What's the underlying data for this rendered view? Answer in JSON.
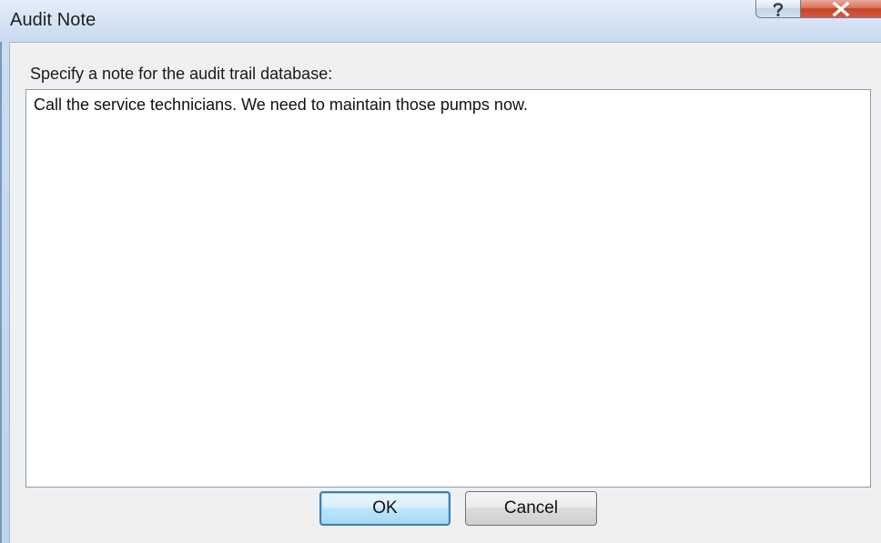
{
  "window": {
    "title": "Audit Note",
    "help_glyph": "?",
    "close_glyph": "X"
  },
  "dialog": {
    "prompt": "Specify a note for the audit trail database:",
    "note_value": "Call the service technicians. We need to maintain those pumps now.",
    "ok_label": "OK",
    "cancel_label": "Cancel"
  },
  "icons": [
    "help-icon",
    "close-icon"
  ],
  "colors": {
    "close_button": "#c7432a",
    "default_button_border": "#3c7fb1",
    "input_border": "#7f9db9"
  }
}
